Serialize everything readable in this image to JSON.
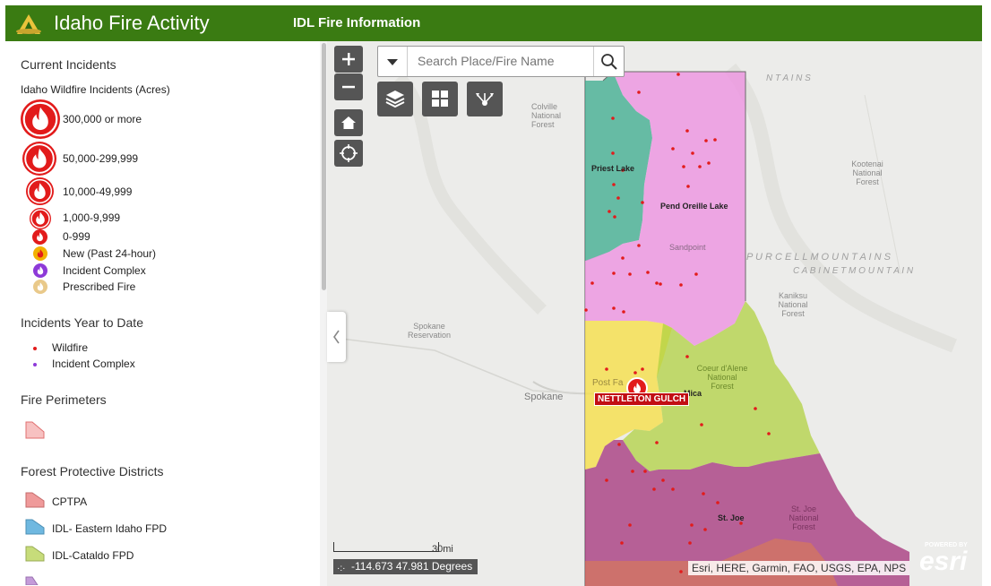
{
  "header": {
    "title": "Idaho Fire Activity",
    "subtitle": "IDL Fire Information",
    "bg_color": "#3a7b12"
  },
  "legend": {
    "current_incidents": {
      "heading": "Current Incidents",
      "subheading": "Idaho Wildfire Incidents (Acres)",
      "items": [
        {
          "label": "300,000 or more",
          "icon": "fire-icon-xl"
        },
        {
          "label": "50,000-299,999",
          "icon": "fire-icon-lg"
        },
        {
          "label": "10,000-49,999",
          "icon": "fire-icon-md"
        },
        {
          "label": "1,000-9,999",
          "icon": "fire-icon-sm"
        },
        {
          "label": "0-999",
          "icon": "fire-icon-xs"
        },
        {
          "label": "New (Past 24-hour)",
          "icon": "fire-icon-new",
          "color": "#f2b100"
        },
        {
          "label": "Incident Complex",
          "icon": "fire-icon-complex",
          "color": "#8e3ad8"
        },
        {
          "label": "Prescribed Fire",
          "icon": "fire-icon-prescribed",
          "color": "#e9c98a"
        }
      ]
    },
    "year_to_date": {
      "heading": "Incidents Year to Date",
      "items": [
        {
          "label": "Wildfire",
          "color": "#e21b1b"
        },
        {
          "label": "Incident Complex",
          "color": "#8e3ad8"
        }
      ]
    },
    "perimeters": {
      "heading": "Fire Perimeters",
      "color": "#f7c1c1"
    },
    "districts": {
      "heading": "Forest Protective Districts",
      "items": [
        {
          "label": "CPTPA",
          "color": "#ef9a9a"
        },
        {
          "label": "IDL- Eastern Idaho FPD",
          "color": "#6fb8e0"
        },
        {
          "label": "IDL-Cataldo FPD",
          "color": "#c7dc7a"
        }
      ]
    }
  },
  "search": {
    "placeholder": "Search Place/Fire Name"
  },
  "map": {
    "scale_label": "30mi",
    "coordinates": "-114.673 47.981 Degrees",
    "attribution": "Esri, HERE, Garmin, FAO, USGS, EPA, NPS",
    "esri_powered": "POWERED BY",
    "esri_logo": "esri",
    "fire_marker_label": "NETTLETON GULCH",
    "labels": {
      "priest_lake": "Priest Lake",
      "pend_oreille": "Pend Oreille Lake",
      "mica": "Mica",
      "st_joe": "St. Joe",
      "spokane": "Spokane",
      "spokane_reservation": "Spokane Reservation",
      "colville": "Colville National Forest",
      "kootenai": "Kootenai National Forest",
      "kaniksu": "Kaniksu National Forest",
      "purcell": "P U R C E L L   M O U N T A I N S",
      "cabinet": "C A B I N E T   M O U N T A I N",
      "selkirk": "N T A I N S",
      "sandpoint": "Sandpoint",
      "post_falls": "Post Fa",
      "coeur_dalene": "Coeur d'Alene National Forest",
      "st_joe_nf": "St. Joe National Forest"
    }
  }
}
